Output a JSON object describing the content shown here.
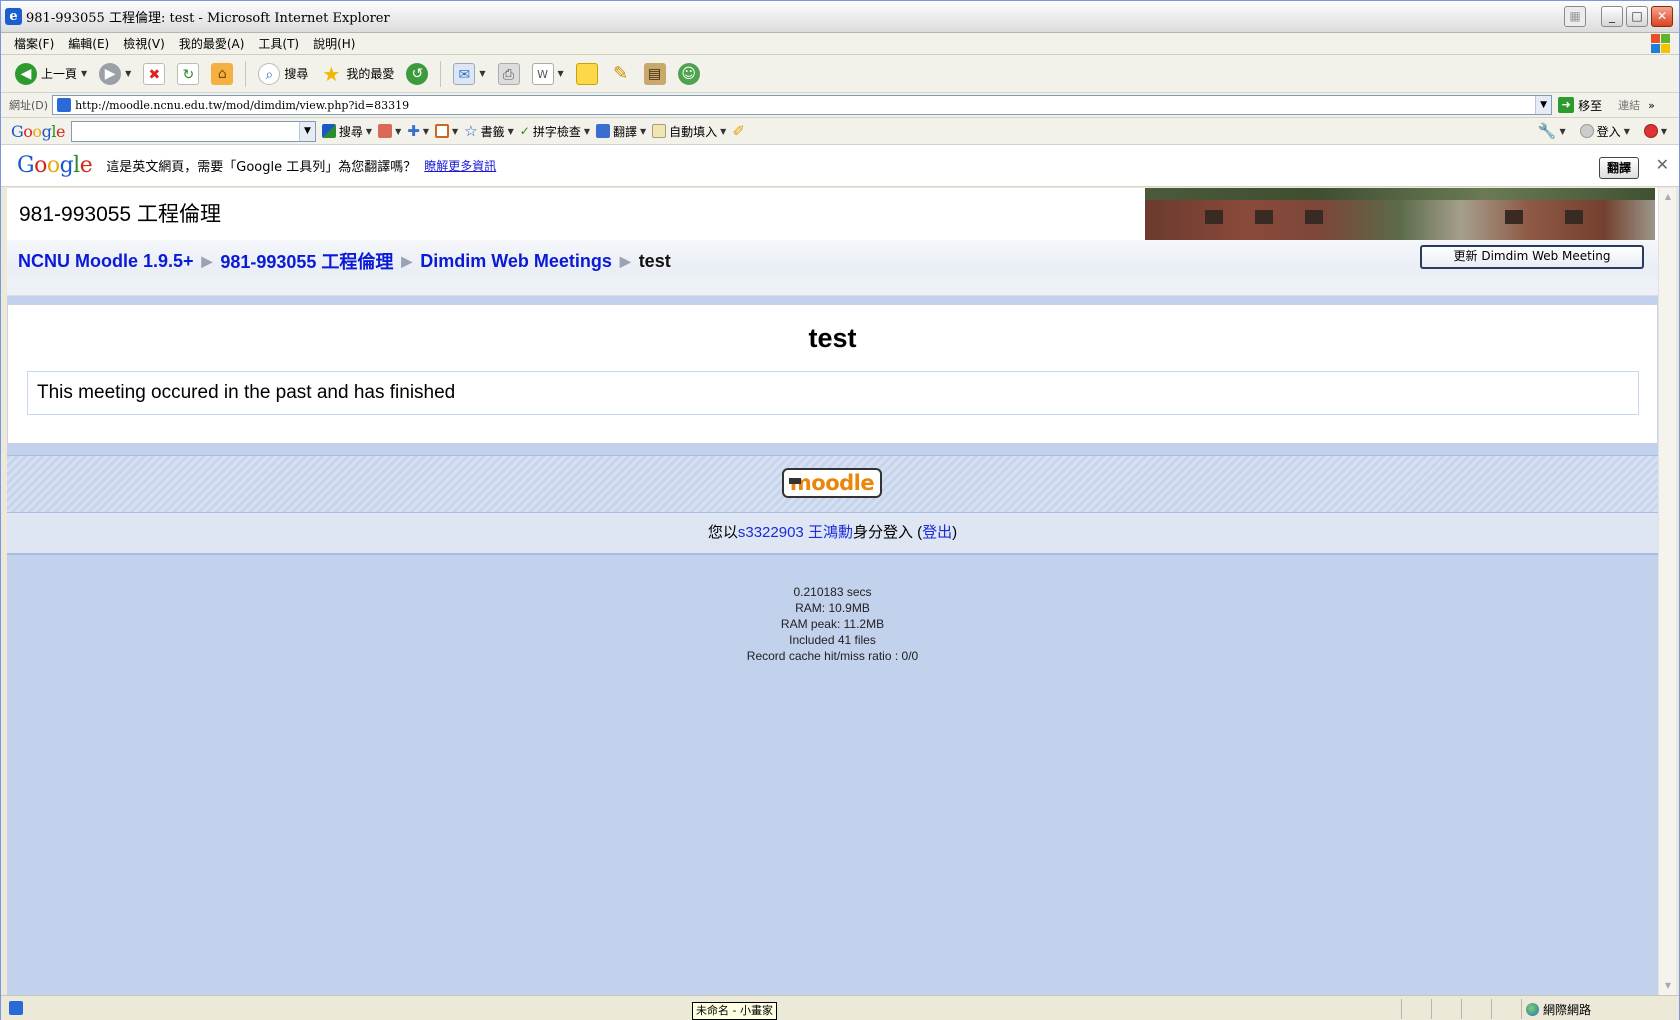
{
  "window": {
    "title": "981-993055 工程倫理: test - Microsoft Internet Explorer",
    "ie_icon_glyph": "e"
  },
  "menu": [
    "檔案(F)",
    "編輯(E)",
    "檢視(V)",
    "我的最愛(A)",
    "工具(T)",
    "說明(H)"
  ],
  "toolbar": {
    "back_label": "上一頁",
    "search_label": "搜尋",
    "favorites_label": "我的最愛"
  },
  "address": {
    "label": "網址(D)",
    "url": "http://moodle.ncnu.edu.tw/mod/dimdim/view.php?id=83319",
    "go_label": "移至",
    "links_label": "連結"
  },
  "google_toolbar": {
    "search_label": "搜尋",
    "bookmarks_label": "書籤",
    "spellcheck_label": "拼字檢查",
    "translate_label": "翻譯",
    "autofill_label": "自動填入",
    "signin_label": "登入"
  },
  "translate_bar": {
    "message": "這是英文網頁，需要「Google 工具列」為您翻譯嗎？",
    "more_link": "瞭解更多資訊",
    "button": "翻譯"
  },
  "page": {
    "course_title": "981-993055 工程倫理",
    "breadcrumbs": [
      "NCNU Moodle 1.9.5+",
      "981-993055 工程倫理",
      "Dimdim Web Meetings"
    ],
    "breadcrumb_current": "test",
    "update_button": "更新 Dimdim Web Meeting",
    "heading": "test",
    "message": "This meeting occured in the past and has finished",
    "moodle_logo": "moodle",
    "login": {
      "prefix": "您以",
      "user": "s3322903 王鴻勳",
      "middle": "身分登入 (",
      "logout": "登出",
      "suffix": ")"
    },
    "perf": [
      "0.210183 secs",
      "RAM: 10.9MB",
      "RAM peak: 11.2MB",
      "Included 41 files",
      "Record cache hit/miss ratio : 0/0"
    ]
  },
  "status": {
    "zone": "網際網路",
    "tooltip": "未命名 - 小畫家"
  }
}
